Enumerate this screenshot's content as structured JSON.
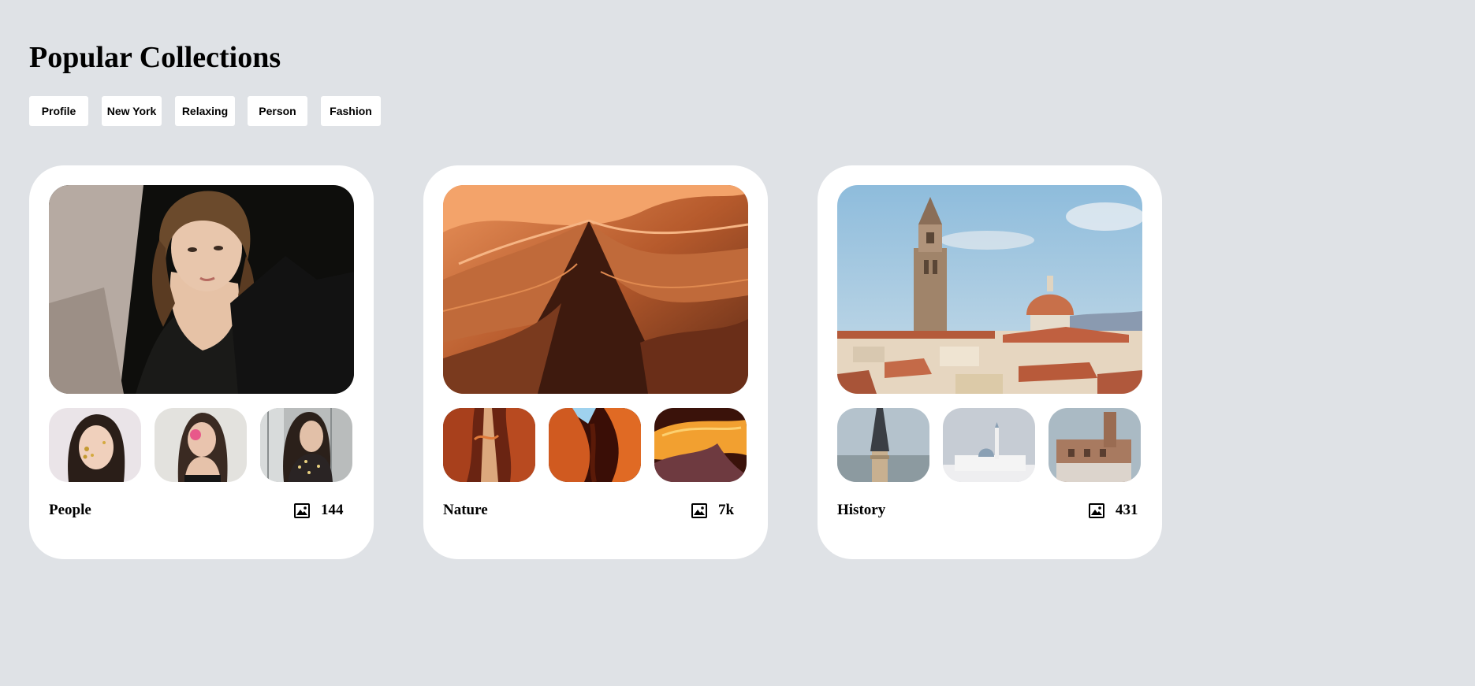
{
  "page": {
    "title": "Popular Collections"
  },
  "tags": [
    {
      "label": "Profile"
    },
    {
      "label": "New York"
    },
    {
      "label": "Relaxing"
    },
    {
      "label": "Person"
    },
    {
      "label": "Fashion"
    }
  ],
  "collections": [
    {
      "name": "People",
      "count": "144",
      "count_icon": "image-icon",
      "hero_image": "woman-in-black-blazer-portrait",
      "thumbnails": [
        "woman-with-gold-leaf-face",
        "woman-with-pink-eye-flower",
        "woman-with-floral-blouse"
      ]
    },
    {
      "name": "Nature",
      "count": "7k",
      "count_icon": "image-icon",
      "hero_image": "antelope-canyon-sandstone-waves",
      "thumbnails": [
        "canyon-light-beam",
        "canyon-orange-walls",
        "canyon-curved-rock"
      ]
    },
    {
      "name": "History",
      "count": "431",
      "count_icon": "image-icon",
      "hero_image": "florence-bell-tower-and-dome",
      "thumbnails": [
        "stone-minaret-tower",
        "white-mosque",
        "brick-palace-tower"
      ]
    }
  ],
  "colors": {
    "background": "#dfe2e6",
    "card": "#ffffff",
    "text": "#000000"
  }
}
